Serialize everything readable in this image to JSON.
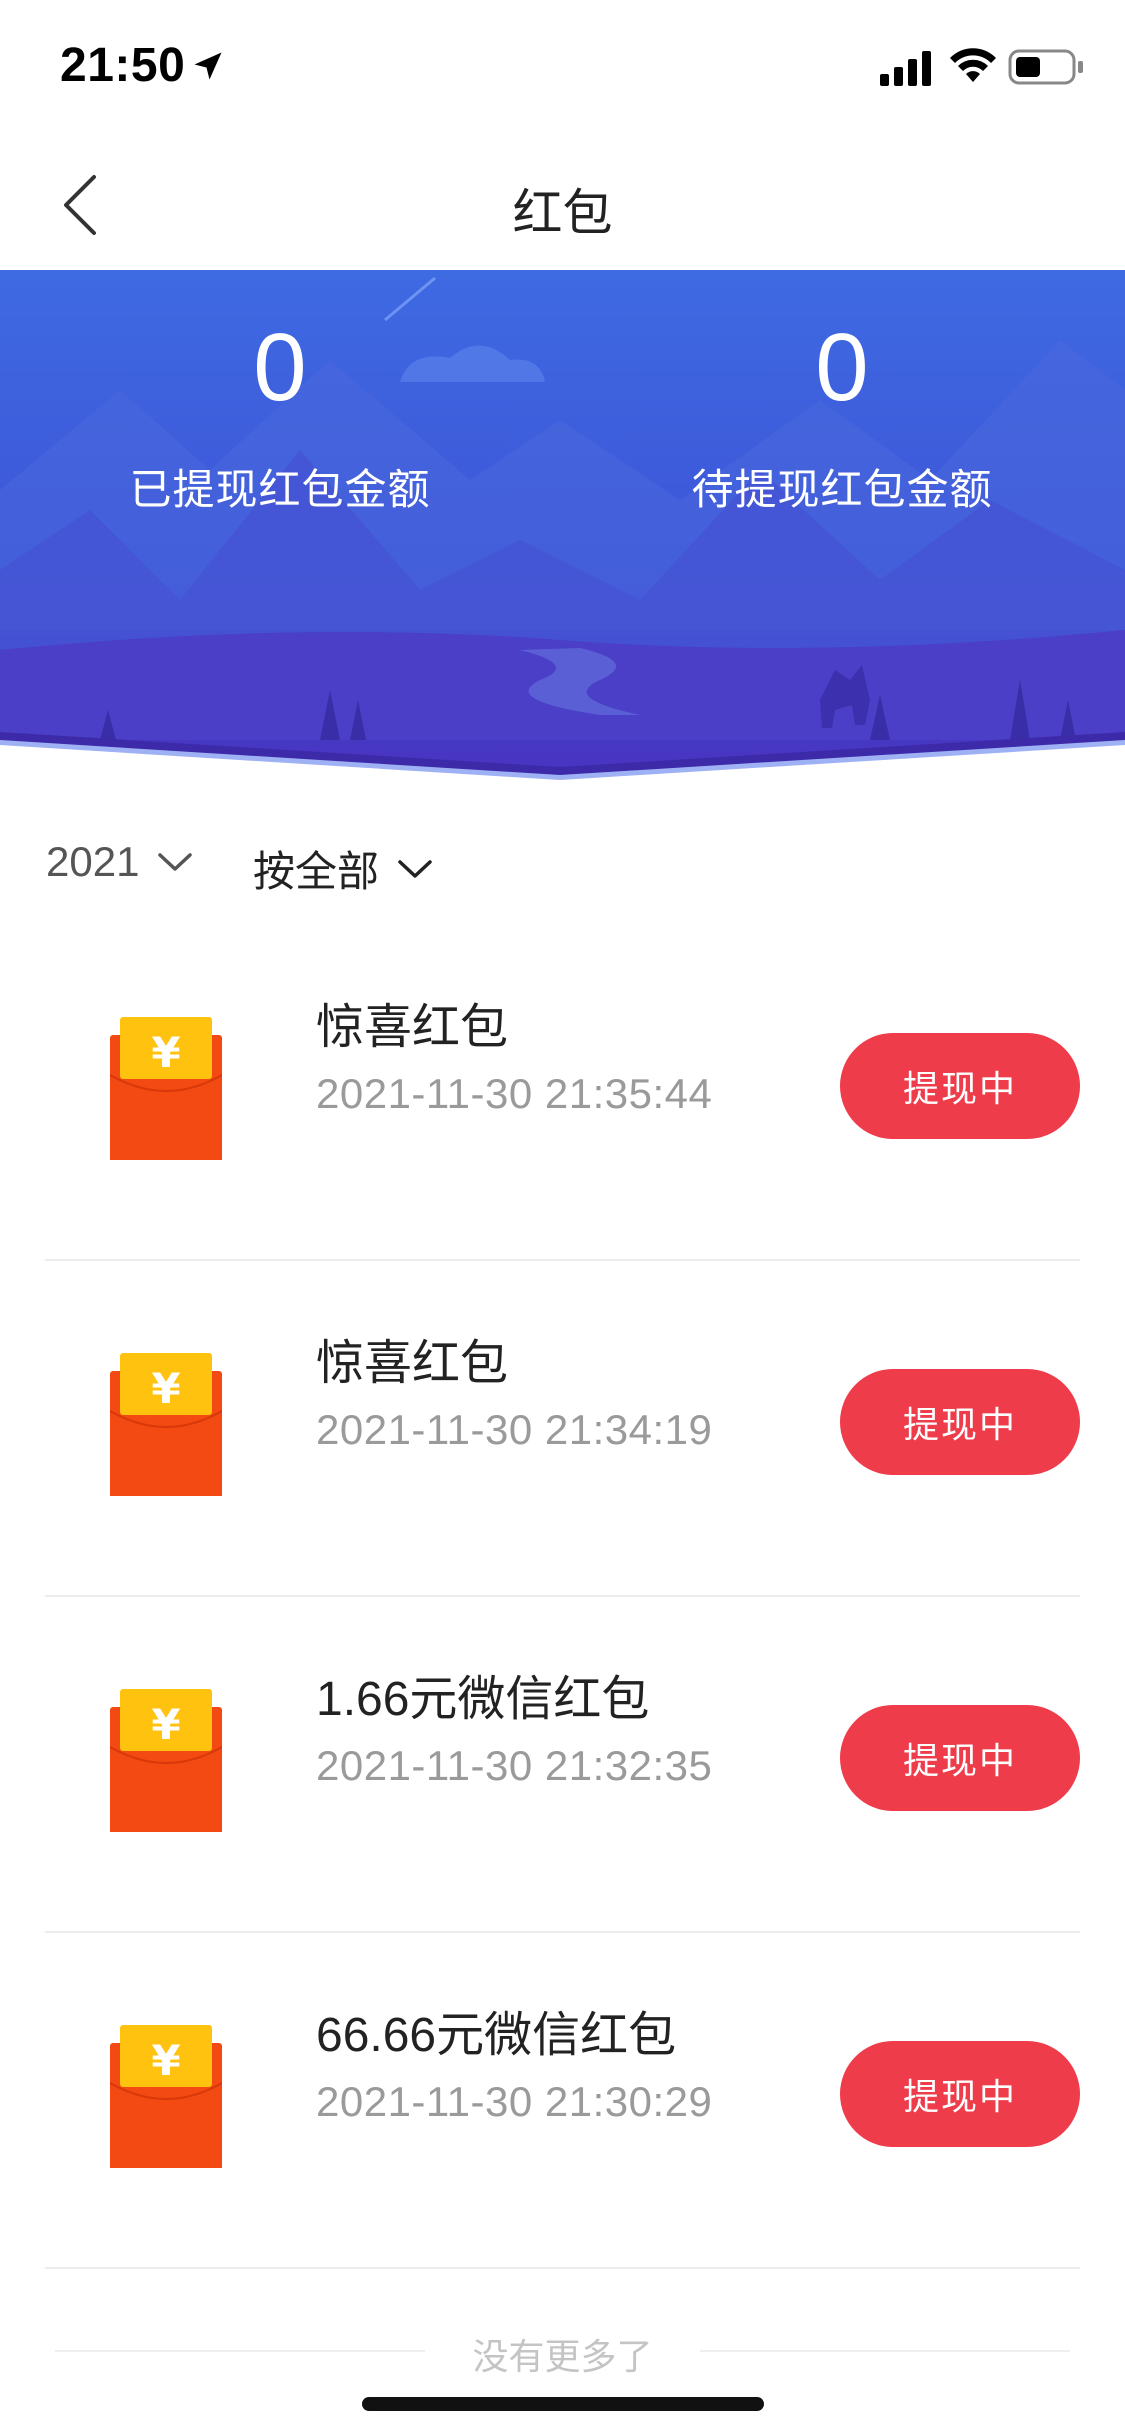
{
  "status_bar": {
    "time": "21:50"
  },
  "nav": {
    "title": "红包"
  },
  "summary": {
    "withdrawn_value": "0",
    "withdrawn_label": "已提现红包金额",
    "pending_value": "0",
    "pending_label": "待提现红包金额"
  },
  "filters": {
    "year": "2021",
    "type": "按全部"
  },
  "items": [
    {
      "title": "惊喜红包",
      "time": "2021-11-30 21:35:44",
      "status": "提现中"
    },
    {
      "title": "惊喜红包",
      "time": "2021-11-30 21:34:19",
      "status": "提现中"
    },
    {
      "title": "1.66元微信红包",
      "time": "2021-11-30 21:32:35",
      "status": "提现中"
    },
    {
      "title": "66.66元微信红包",
      "time": "2021-11-30 21:30:29",
      "status": "提现中"
    }
  ],
  "footer": {
    "no_more": "没有更多了"
  },
  "colors": {
    "banner_top": "#3d66e0",
    "banner_bottom": "#4a2fc0",
    "status_button": "#ee3c4a",
    "envelope_red": "#f24a12",
    "envelope_yellow": "#ffc20e"
  },
  "icons": {
    "envelope": "red-envelope-icon",
    "currency": "yen"
  },
  "envelope_glyph": "¥"
}
